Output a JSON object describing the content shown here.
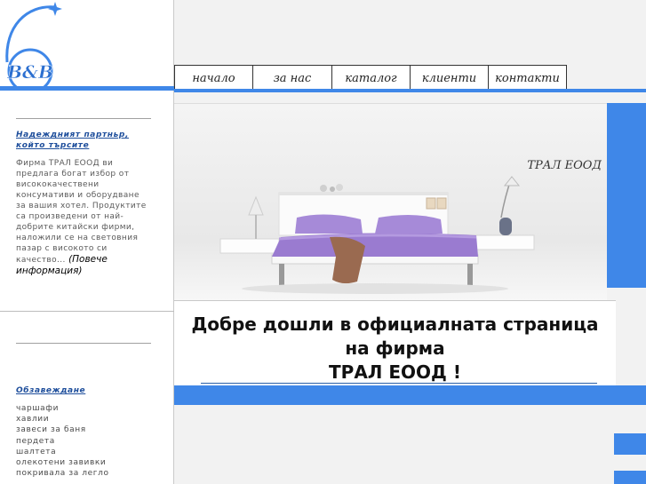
{
  "logo": {
    "text": "B&B"
  },
  "nav": {
    "items": [
      {
        "label": "начало"
      },
      {
        "label": "за нас"
      },
      {
        "label": "каталог"
      },
      {
        "label": "клиенти"
      },
      {
        "label": "контакти"
      }
    ]
  },
  "sidebar": {
    "intro_heading": "Надеждният партньр, който търсите",
    "intro_text": "Фирма ТРАЛ ЕООД ви предлага богат избор от висококачествени консумативи и оборудване за вашия хотел. Продуктите са произведени от най-добрите китайски фирми, наложили се на световния пазар с високото си качество...",
    "intro_more": "(Повече информация)",
    "furnish_heading": "Обзавеждане",
    "furnish_items": [
      "чаршафи",
      "хавлии",
      "завеси за баня",
      "пердета",
      "шалтета",
      "олекотени завивки",
      "покривала за легло"
    ]
  },
  "hero": {
    "brand": "ТРАЛ ЕООД"
  },
  "welcome": {
    "line1": "Добре дошли в официалната страница",
    "line2": "на фирма",
    "line3": "ТРАЛ ЕООД !"
  },
  "colors": {
    "accent": "#3f87e8",
    "bed_linen": "#9a7bd0",
    "throw": "#9a6a50"
  }
}
